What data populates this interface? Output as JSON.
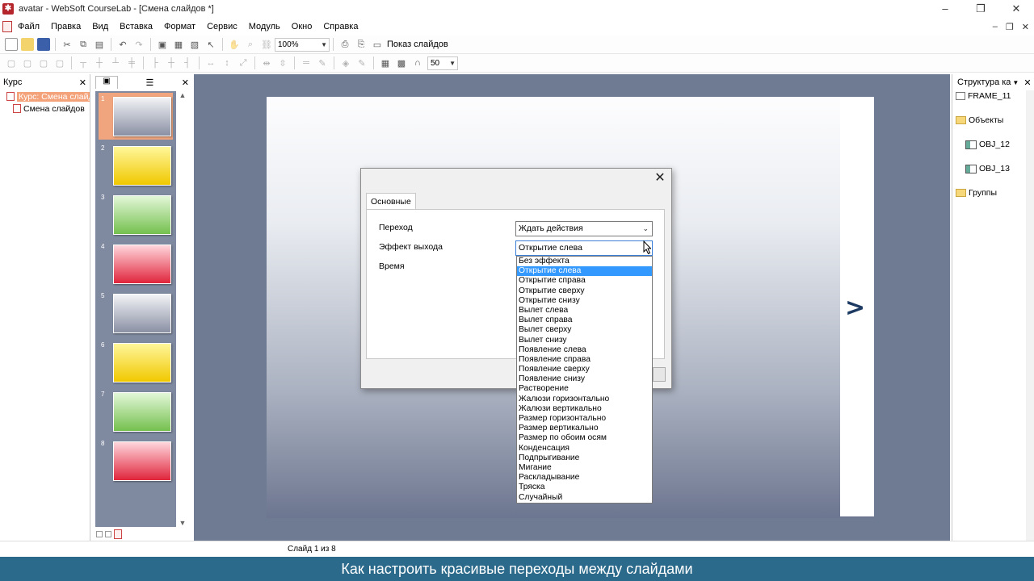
{
  "window": {
    "title": "avatar - WebSoft CourseLab - [Смена слайдов *]",
    "controls": [
      "–",
      "❐",
      "✕"
    ],
    "mdi_controls": [
      "–",
      "❐",
      "✕"
    ]
  },
  "menu": [
    "Файл",
    "Правка",
    "Вид",
    "Вставка",
    "Формат",
    "Сервис",
    "Модуль",
    "Окно",
    "Справка"
  ],
  "toolbar1": {
    "zoom": "100%",
    "slideshow_label": "Показ слайдов"
  },
  "toolbar2": {
    "grid_size": "50"
  },
  "course_panel": {
    "title": "Курс",
    "items": [
      {
        "label": "Курс: Смена слайд",
        "selected": true
      },
      {
        "label": "Смена слайдов",
        "selected": false
      }
    ]
  },
  "slides": [
    {
      "num": "1",
      "color": "gray",
      "selected": true
    },
    {
      "num": "2",
      "color": "yellow",
      "selected": false
    },
    {
      "num": "3",
      "color": "green",
      "selected": false
    },
    {
      "num": "4",
      "color": "red",
      "selected": false
    },
    {
      "num": "5",
      "color": "gray",
      "selected": false
    },
    {
      "num": "6",
      "color": "yellow",
      "selected": false
    },
    {
      "num": "7",
      "color": "green",
      "selected": false
    },
    {
      "num": "8",
      "color": "red",
      "selected": false
    }
  ],
  "slide_nav_glyph": ">",
  "structure_panel": {
    "title": "Структура ка",
    "items": [
      {
        "label": "FRAME_11",
        "kind": "frame"
      },
      {
        "label": "Объекты",
        "kind": "folder"
      },
      {
        "label": "OBJ_12",
        "kind": "object"
      },
      {
        "label": "OBJ_13",
        "kind": "object"
      },
      {
        "label": "Группы",
        "kind": "folder"
      }
    ]
  },
  "dialog": {
    "tab": "Основные",
    "labels": {
      "transition": "Переход",
      "exit_effect": "Эффект выхода",
      "time": "Время"
    },
    "transition_value": "Ждать действия",
    "exit_effect_value": "Открытие слева",
    "options": [
      "Без эффекта",
      "Открытие слева",
      "Открытие справа",
      "Открытие сверху",
      "Открытие снизу",
      "Вылет слева",
      "Вылет справа",
      "Вылет сверху",
      "Вылет снизу",
      "Появление слева",
      "Появление справа",
      "Появление сверху",
      "Появление снизу",
      "Растворение",
      "Жалюзи горизонтально",
      "Жалюзи вертикально",
      "Размер горизонтально",
      "Размер вертикально",
      "Размер по обоим осям",
      "Конденсация",
      "Подпрыгивание",
      "Мигание",
      "Раскладывание",
      "Тряска",
      "Случайный"
    ],
    "selected_option": "Открытие слева"
  },
  "status": {
    "slide_info": "Слайд 1 из 8"
  },
  "subtitle": "Как настроить красивые переходы между слайдами",
  "colors": {
    "workspace": "#6f7b93",
    "selection": "#3399ff",
    "subtitle_bg": "#2b6a8b",
    "slide_arrow": "#1d3a63"
  }
}
